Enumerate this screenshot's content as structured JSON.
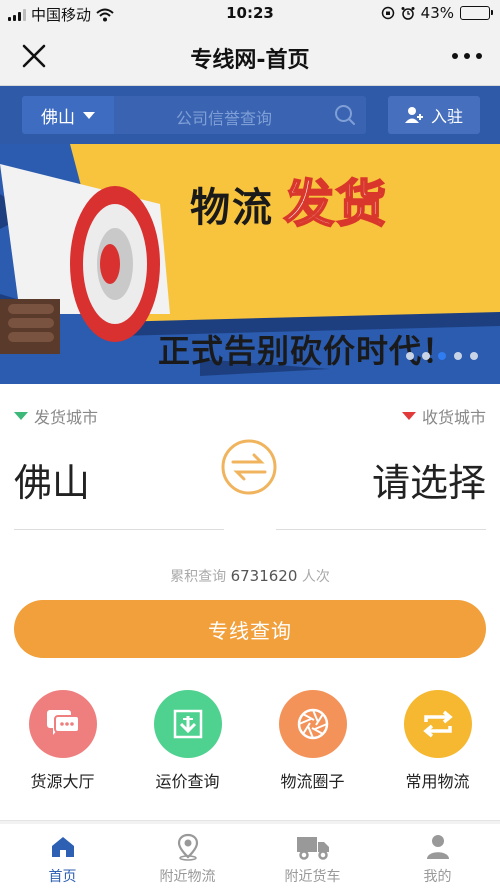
{
  "status_bar": {
    "carrier": "中国移动",
    "time": "10:23",
    "battery_percent": "43%",
    "battery_level": 0.43
  },
  "nav": {
    "title": "专线网-首页"
  },
  "search": {
    "city": "佛山",
    "placeholder": "公司信誉查询",
    "join_label": "入驻"
  },
  "banner": {
    "headline_prefix": "物流",
    "headline_highlight": "发货",
    "headline_line2": "正式告别砍价时代！",
    "slide_count": 5,
    "active_slide": 3
  },
  "route": {
    "from_label": "发货城市",
    "to_label": "收货城市",
    "from_city": "佛山",
    "to_city": "请选择"
  },
  "stats": {
    "prefix": "累积查询",
    "count": "6731620",
    "suffix": "人次"
  },
  "main_button": "专线查询",
  "features": [
    {
      "label": "货源大厅",
      "icon": "chat-bubbles-icon",
      "color": "#ef7f7f"
    },
    {
      "label": "运价查询",
      "icon": "price-download-icon",
      "color": "#4fd18f"
    },
    {
      "label": "物流圈子",
      "icon": "aperture-icon",
      "color": "#f3935a"
    },
    {
      "label": "常用物流",
      "icon": "repeat-icon",
      "color": "#f5b830"
    }
  ],
  "tabs": [
    {
      "label": "首页",
      "icon": "home-icon",
      "active": true
    },
    {
      "label": "附近物流",
      "icon": "location-pin-icon",
      "active": false
    },
    {
      "label": "附近货车",
      "icon": "truck-icon",
      "active": false
    },
    {
      "label": "我的",
      "icon": "person-icon",
      "active": false
    }
  ],
  "colors": {
    "accent_orange": "#f1a03c",
    "banner_blue": "#2d5fb3",
    "active_tab": "#2d5fb3"
  }
}
